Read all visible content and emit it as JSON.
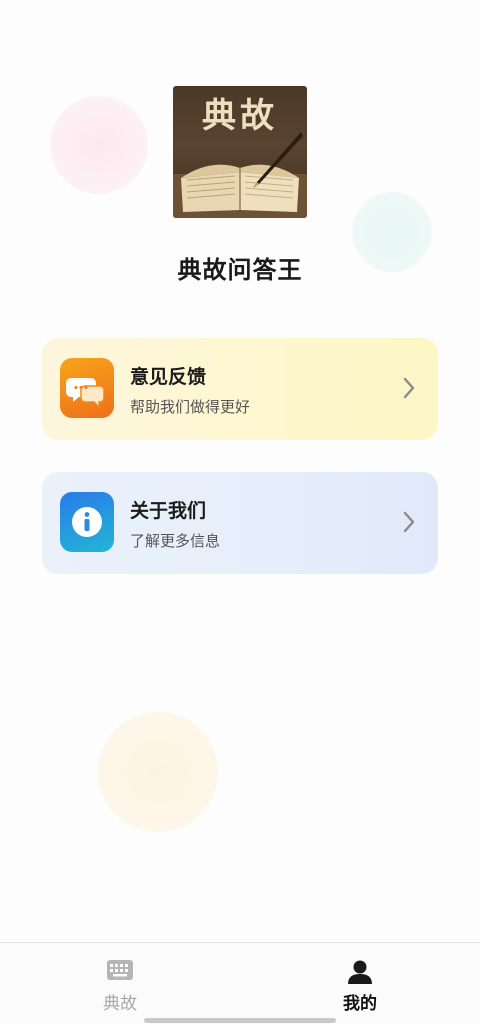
{
  "app": {
    "logo_text": "典故",
    "title": "典故问答王"
  },
  "menu": [
    {
      "title": "意见反馈",
      "subtitle": "帮助我们做得更好",
      "icon": "chat-bubbles-icon"
    },
    {
      "title": "关于我们",
      "subtitle": "了解更多信息",
      "icon": "info-icon"
    }
  ],
  "tabbar": {
    "items": [
      {
        "label": "典故",
        "icon": "keyboard-icon",
        "active": false
      },
      {
        "label": "我的",
        "icon": "person-icon",
        "active": true
      }
    ]
  },
  "colors": {
    "feedback_icon": "#f08a1a",
    "about_icon": "#2a8be0",
    "active_tab": "#111111",
    "inactive_tab": "#a9a9a9"
  }
}
